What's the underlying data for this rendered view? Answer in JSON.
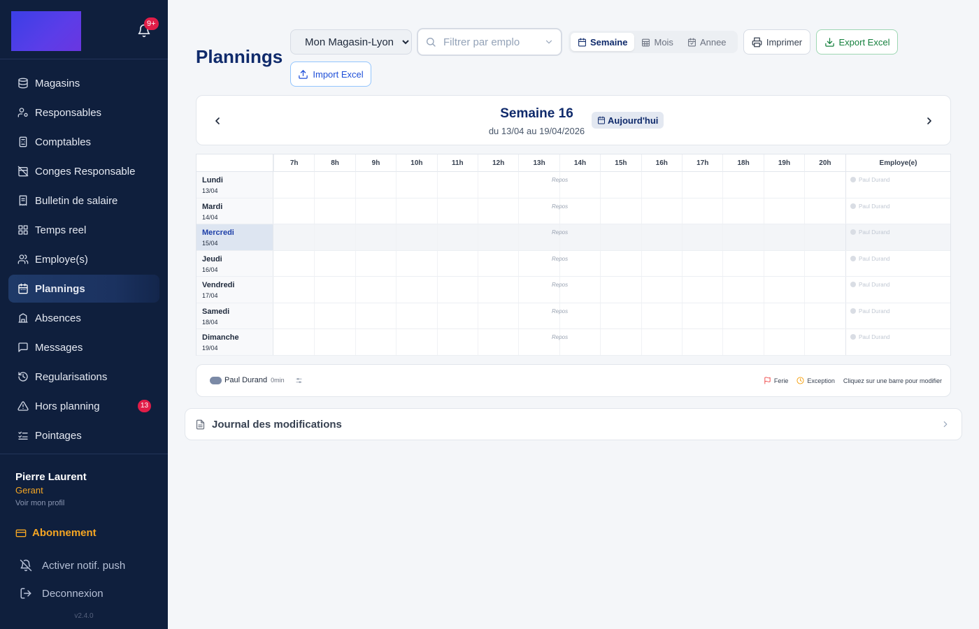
{
  "sidebar": {
    "notification_count": "9+",
    "items": [
      {
        "label": "Magasins",
        "icon": "store-icon"
      },
      {
        "label": "Responsables",
        "icon": "user-key-icon"
      },
      {
        "label": "Comptables",
        "icon": "calculator-icon"
      },
      {
        "label": "Conges Responsable",
        "icon": "calendar-off-icon"
      },
      {
        "label": "Bulletin de salaire",
        "icon": "receipt-icon"
      },
      {
        "label": "Temps reel",
        "icon": "dashboard-icon"
      },
      {
        "label": "Employe(s)",
        "icon": "users-icon"
      },
      {
        "label": "Plannings",
        "icon": "calendar-icon",
        "active": true
      },
      {
        "label": "Absences",
        "icon": "user-x-icon"
      },
      {
        "label": "Messages",
        "icon": "message-icon"
      },
      {
        "label": "Regularisations",
        "icon": "history-icon"
      },
      {
        "label": "Hors planning",
        "icon": "alert-icon",
        "badge": "13"
      },
      {
        "label": "Pointages",
        "icon": "checklist-icon"
      }
    ],
    "user": {
      "name": "Pierre Laurent",
      "role": "Gerant",
      "profile_link": "Voir mon profil"
    },
    "subscription_label": "Abonnement",
    "push_label": "Activer notif. push",
    "logout_label": "Deconnexion",
    "version": "v2.4.0"
  },
  "header": {
    "title": "Plannings",
    "store_select": {
      "value": "Mon Magasin-Lyon",
      "options": [
        "Mon Magasin-Lyon"
      ]
    },
    "filter_placeholder": "Filtrer par emplo",
    "views": [
      "Semaine",
      "Mois",
      "Annee"
    ],
    "active_view": "Semaine",
    "print_label": "Imprimer",
    "export_label": "Export Excel",
    "import_label": "Import Excel"
  },
  "week": {
    "title": "Semaine 16",
    "range": "du 13/04 au 19/04/2026",
    "today_label": "Aujourd'hui"
  },
  "grid": {
    "hours": [
      "7h",
      "8h",
      "9h",
      "10h",
      "11h",
      "12h",
      "13h",
      "14h",
      "15h",
      "16h",
      "17h",
      "18h",
      "19h",
      "20h"
    ],
    "employee_header": "Employe(e)",
    "days": [
      {
        "name": "Lundi",
        "date": "13/04",
        "status": "Repos",
        "employee": "Paul Durand"
      },
      {
        "name": "Mardi",
        "date": "14/04",
        "status": "Repos",
        "employee": "Paul Durand"
      },
      {
        "name": "Mercredi",
        "date": "15/04",
        "status": "Repos",
        "employee": "Paul Durand",
        "today": true
      },
      {
        "name": "Jeudi",
        "date": "16/04",
        "status": "Repos",
        "employee": "Paul Durand"
      },
      {
        "name": "Vendredi",
        "date": "17/04",
        "status": "Repos",
        "employee": "Paul Durand"
      },
      {
        "name": "Samedi",
        "date": "18/04",
        "status": "Repos",
        "employee": "Paul Durand"
      },
      {
        "name": "Dimanche",
        "date": "19/04",
        "status": "Repos",
        "employee": "Paul Durand"
      }
    ]
  },
  "legend": {
    "employee": "Paul Durand",
    "minutes": "0min",
    "ferie": "Ferie",
    "exception": "Exception",
    "hint": "Cliquez sur une barre pour modifier"
  },
  "journal": {
    "title": "Journal des modifications"
  },
  "colors": {
    "sidebar_bg": "#0f1f3d",
    "accent": "#0f2a6b",
    "badge": "#e11d48",
    "gold": "#f5a623",
    "export_green": "#15803d",
    "import_blue": "#1d4ed8"
  }
}
